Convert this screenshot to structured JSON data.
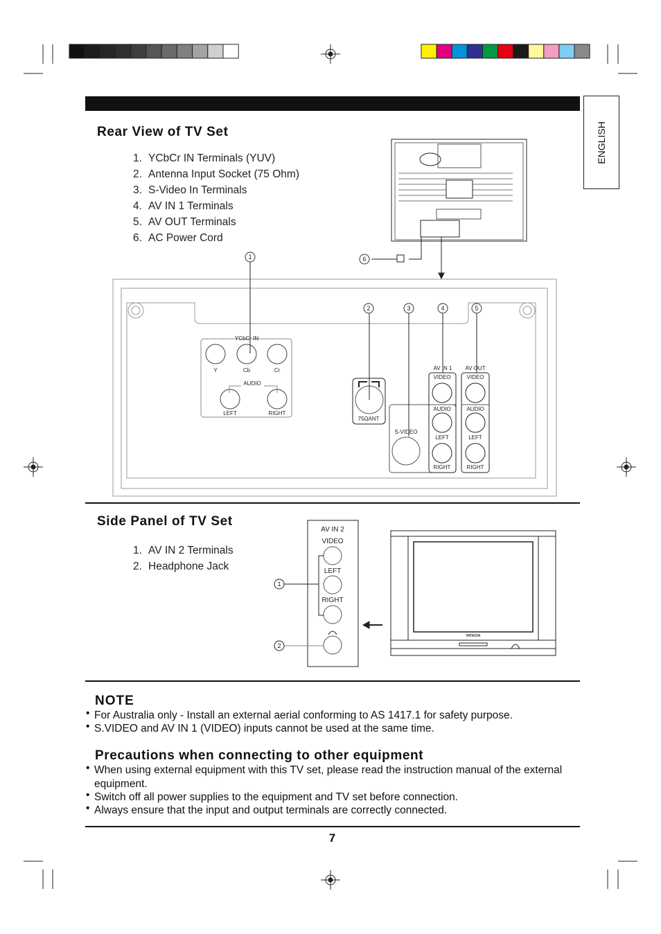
{
  "color_bars": {
    "grayscale": [
      "#111111",
      "#1c1c1c",
      "#262626",
      "#303030",
      "#3e3e3e",
      "#555555",
      "#6a6a6a",
      "#808080",
      "#a3a3a3",
      "#d0d0d0",
      "#ffffff"
    ],
    "colors": [
      "#fff200",
      "#e4007f",
      "#0095d9",
      "#2e3192",
      "#009944",
      "#e60012",
      "#1a1a1a",
      "#fff799",
      "#f19ec2",
      "#7ecef4",
      "#898989"
    ]
  },
  "language_tab": "ENGLISH",
  "rear": {
    "title": "Rear View of TV Set",
    "items": [
      {
        "num": "1.",
        "label": "YCbCr IN Terminals (YUV)"
      },
      {
        "num": "2.",
        "label": "Antenna Input Socket (75 Ohm)"
      },
      {
        "num": "3.",
        "label": "S-Video In Terminals"
      },
      {
        "num": "4.",
        "label": "AV IN 1 Terminals"
      },
      {
        "num": "5.",
        "label": "AV OUT Terminals"
      },
      {
        "num": "6.",
        "label": "AC Power Cord"
      }
    ],
    "callouts": [
      "1",
      "2",
      "3",
      "4",
      "5",
      "6"
    ],
    "panel": {
      "ycbcr_in": "YCbCr IN",
      "y": "Y",
      "cb": "Cb",
      "cr": "Cr",
      "audio": "AUDIO",
      "left": "LEFT",
      "right": "RIGHT",
      "ant": "75ΩANT",
      "svideo": "S-VIDEO",
      "av_in1": "AV IN 1",
      "av_out": "AV OUT",
      "video": "VIDEO"
    }
  },
  "side": {
    "title": "Side Panel of TV Set",
    "items": [
      {
        "num": "1.",
        "label": "AV IN 2 Terminals"
      },
      {
        "num": "2.",
        "label": "Headphone Jack"
      }
    ],
    "callouts": [
      "1",
      "2"
    ],
    "panel": {
      "av_in2": "AV IN 2",
      "video": "VIDEO",
      "left": "LEFT",
      "right": "RIGHT"
    },
    "brand": "HITACHI"
  },
  "note": {
    "title": "NOTE",
    "bullets": [
      "For Australia only - Install an external aerial conforming to AS 1417.1 for safety purpose.",
      "S.VIDEO and AV IN 1 (VIDEO) inputs cannot be used at the same time."
    ]
  },
  "precautions": {
    "title": "Precautions when connecting to other equipment",
    "bullets": [
      "When using external equipment with this TV set, please read the instruction manual of the external equipment.",
      "Switch off all power supplies to the equipment and TV set before connection.",
      "Always ensure that the input and output terminals are correctly connected."
    ]
  },
  "bullet_char": "•",
  "page_number": "7"
}
